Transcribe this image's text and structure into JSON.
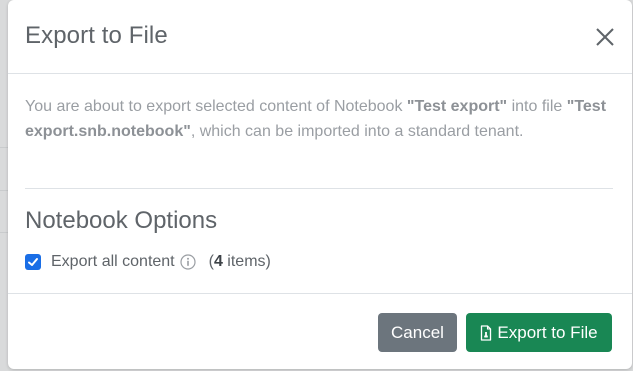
{
  "modal": {
    "title": "Export to File",
    "close_icon": "close-icon"
  },
  "description": {
    "prefix": "You are about to export selected content of Notebook ",
    "notebook_name": "\"Test export\"",
    "middle": " into file ",
    "file_name": "\"Test export.snb.notebook\"",
    "suffix": ", which can be imported into a standard tenant."
  },
  "notebook_options": {
    "title": "Notebook Options",
    "export_all": {
      "label": "Export all content",
      "checked": true,
      "info_icon": "info-icon"
    },
    "count_open": "(",
    "count_value": "4",
    "count_suffix": " items)"
  },
  "footer": {
    "cancel_label": "Cancel",
    "export_label": "Export to File",
    "export_icon": "file-export-icon"
  },
  "colors": {
    "checkbox": "#1a6ee6",
    "cancel_button": "#6c757d",
    "export_button": "#198754"
  }
}
